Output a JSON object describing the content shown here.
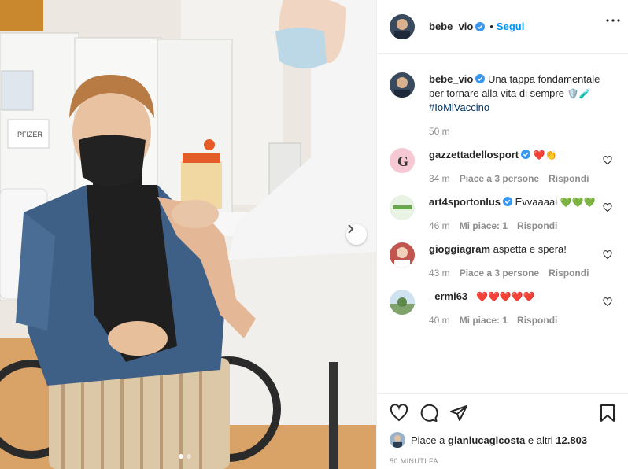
{
  "post": {
    "username": "bebe_vio",
    "follow_label": "Segui",
    "caption_text": "Una tappa fondamentale per tornare alla vita di sempre",
    "caption_emoji": "🛡️🧪",
    "caption_hashtag": "#IoMiVaccino",
    "caption_time": "50 m",
    "photo_label": "PFIZER",
    "carousel_index": 1,
    "carousel_count": 2
  },
  "comments": [
    {
      "username": "gazzettadellosport",
      "verified": true,
      "text": "",
      "emoji": "❤️👏",
      "time": "34 m",
      "likes": "Piace a 3 persone",
      "reply": "Rispondi",
      "avatar_color": "#f6c8d3"
    },
    {
      "username": "art4sportonlus",
      "verified": true,
      "text": "Evvaaaai",
      "emoji": "💚💚💚",
      "time": "46 m",
      "likes": "Mi piace: 1",
      "reply": "Rispondi",
      "avatar_color": "#e8f3e4"
    },
    {
      "username": "gioggiagram",
      "verified": false,
      "text": "aspetta e spera!",
      "emoji": "",
      "time": "43 m",
      "likes": "Piace a 3 persone",
      "reply": "Rispondi",
      "avatar_color": "#c0564f"
    },
    {
      "username": "_ermi63_",
      "verified": false,
      "text": "",
      "emoji": "❤️❤️❤️❤️❤️",
      "time": "40 m",
      "likes": "Mi piace: 1",
      "reply": "Rispondi",
      "avatar_color": "#7fa36a"
    }
  ],
  "likes": {
    "prefix": "Piace a",
    "user": "gianlucaglcosta",
    "suffix": "e altri",
    "count": "12.803"
  },
  "timestamp": "50 MINUTI FA",
  "colors": {
    "link": "#0095f6",
    "verified": "#3897f0",
    "muted": "#8e8e8e"
  }
}
